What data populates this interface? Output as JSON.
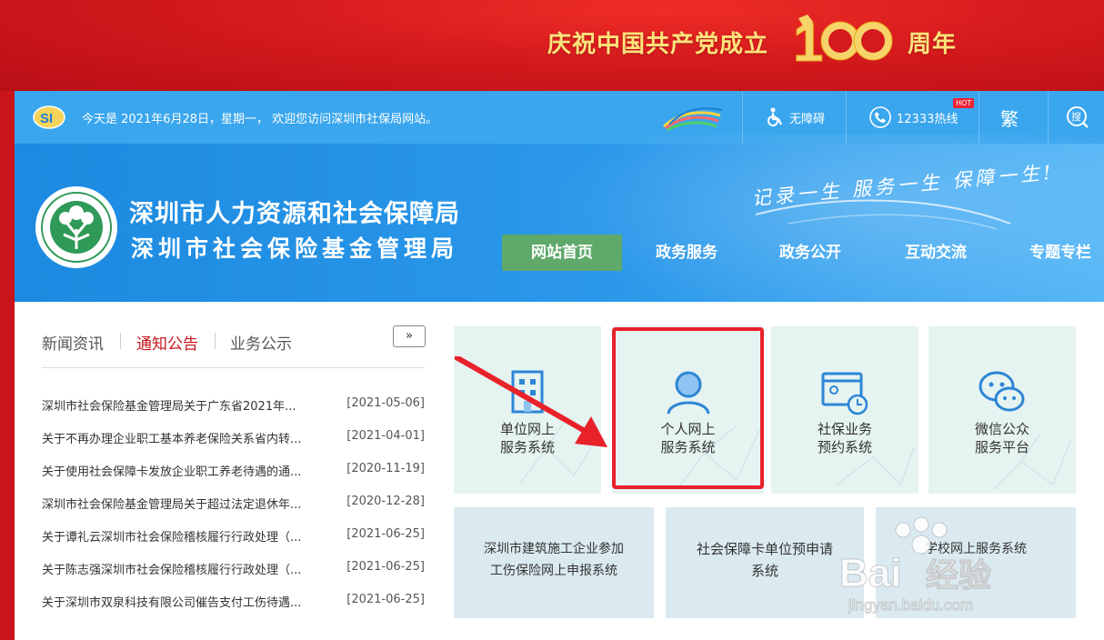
{
  "banner": {
    "left": "庆祝中国共产党成立",
    "right": "周年",
    "emblem_number": "100"
  },
  "topbar": {
    "date_text": "今天是 2021年6月28日，星期一， 欢迎您访问深圳市社保局网站。",
    "accessibility_label": "无障碍",
    "hotline_label": "12333热线",
    "hot_badge": "HOT",
    "traditional_label": "繁",
    "search_label": "搜"
  },
  "header": {
    "org_name": "深圳市人力资源和社会保障局",
    "org_subname": "深圳市社会保险基金管理局",
    "motto": "记录一生 服务一生 保障一生!"
  },
  "nav": [
    "网站首页",
    "政务服务",
    "政务公开",
    "互动交流",
    "专题专栏"
  ],
  "news": {
    "tabs": [
      "新闻资讯",
      "通知公告",
      "业务公示"
    ],
    "active_tab": "通知公告",
    "more_label": "»",
    "items": [
      {
        "title": "深圳市社会保险基金管理局关于广东省2021年...",
        "date": "[2021-05-06]"
      },
      {
        "title": "关于不再办理企业职工基本养老保险关系省内转...",
        "date": "[2021-04-01]"
      },
      {
        "title": "关于使用社会保障卡发放企业职工养老待遇的通...",
        "date": "[2020-11-19]"
      },
      {
        "title": "深圳市社会保险基金管理局关于超过法定退休年...",
        "date": "[2020-12-28]"
      },
      {
        "title": "关于谭礼云深圳市社会保险稽核履行行政处理（...",
        "date": "[2021-06-25]"
      },
      {
        "title": "关于陈志强深圳市社会保险稽核履行行政处理（...",
        "date": "[2021-06-25]"
      },
      {
        "title": "关于深圳市双泉科技有限公司催告支付工伤待遇...",
        "date": "[2021-06-25]"
      }
    ]
  },
  "services": [
    {
      "line1": "单位网上",
      "line2": "服务系统",
      "icon": "building-icon"
    },
    {
      "line1": "个人网上",
      "line2": "服务系统",
      "icon": "person-icon"
    },
    {
      "line1": "社保业务",
      "line2": "预约系统",
      "icon": "appointment-icon"
    },
    {
      "line1": "微信公众",
      "line2": "服务平台",
      "icon": "wechat-icon"
    }
  ],
  "services2": [
    {
      "line1": "深圳市建筑施工企业参加",
      "line2": "工伤保险网上申报系统"
    },
    {
      "line1": "社会保障卡单位预申请",
      "line2": "系统"
    },
    {
      "line1": "学校网上服务系统",
      "line2": ""
    }
  ],
  "watermark": {
    "brand": "Bai",
    "cn": "经验",
    "url": "jingyan.baidu.com"
  },
  "colors": {
    "primary": "#2b98ea",
    "active_nav": "#5fa96a",
    "highlight": "#e8212b",
    "banner_red": "#d41a1d"
  }
}
